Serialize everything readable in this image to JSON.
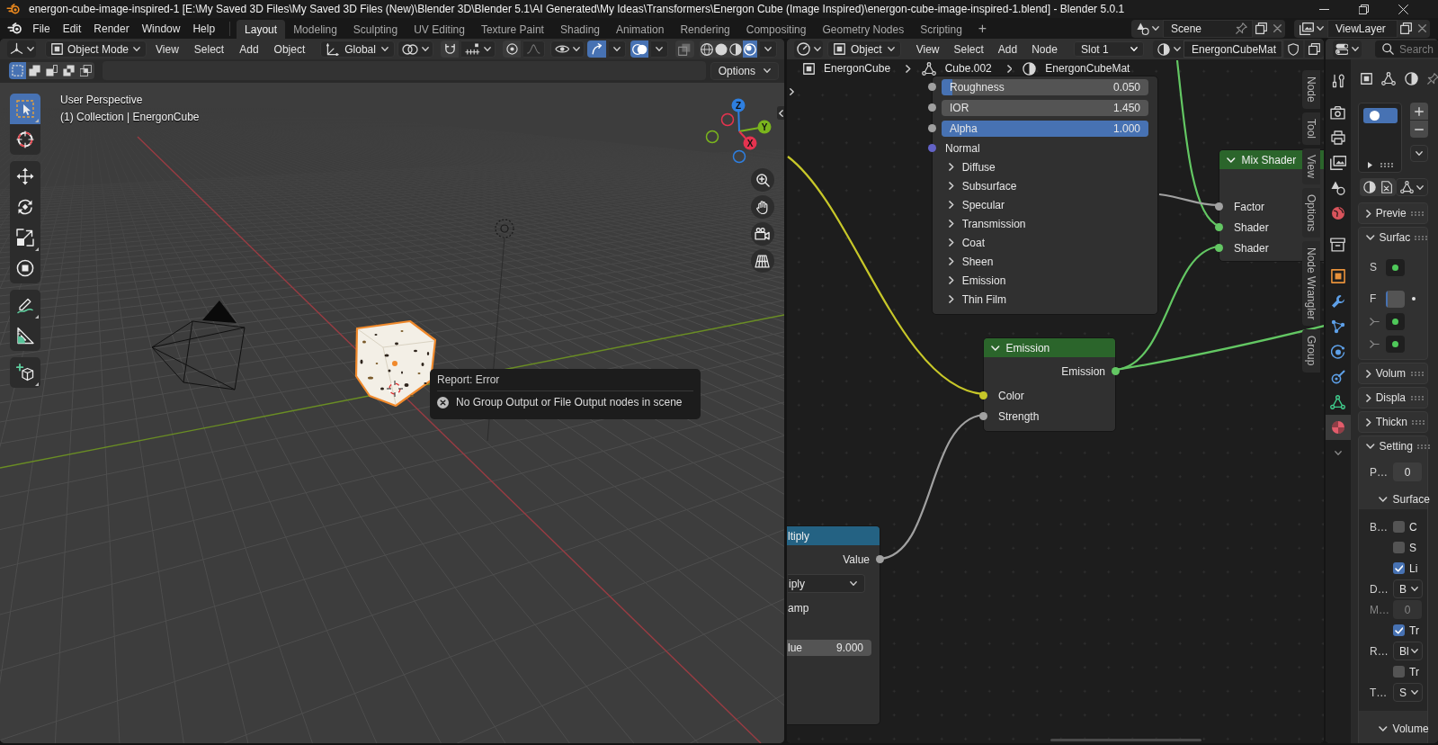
{
  "window": {
    "title": "energon-cube-image-inspired-1 [E:\\My Saved 3D Files\\My Saved 3D Files (New)\\Blender 3D\\Blender 5.1\\AI Generated\\My Ideas\\Transformers\\Energon Cube (Image Inspired)\\energon-cube-image-inspired-1.blend] - Blender 5.0.1"
  },
  "menu_bar": {
    "menus": [
      "File",
      "Edit",
      "Render",
      "Window",
      "Help"
    ]
  },
  "workspace_tabs": [
    {
      "label": "Layout",
      "selected": true
    },
    {
      "label": "Modeling",
      "selected": false
    },
    {
      "label": "Sculpting",
      "selected": false
    },
    {
      "label": "UV Editing",
      "selected": false
    },
    {
      "label": "Texture Paint",
      "selected": false
    },
    {
      "label": "Shading",
      "selected": false
    },
    {
      "label": "Animation",
      "selected": false
    },
    {
      "label": "Rendering",
      "selected": false
    },
    {
      "label": "Compositing",
      "selected": false
    },
    {
      "label": "Geometry Nodes",
      "selected": false
    },
    {
      "label": "Scripting",
      "selected": false
    }
  ],
  "add_workspace": "+",
  "scene": {
    "value": "Scene"
  },
  "view_layer": {
    "value": "ViewLayer"
  },
  "viewport": {
    "header": {
      "mode": "Object Mode",
      "menus": [
        "View",
        "Select",
        "Add",
        "Object"
      ],
      "orientation": "Global",
      "toggles": [
        {
          "kind": "gizmos",
          "on": true
        },
        {
          "kind": "overlays",
          "on": true
        },
        {
          "kind": "xray",
          "on": false
        }
      ],
      "shading": [
        {
          "kind": "wireframe",
          "selected": false
        },
        {
          "kind": "solid",
          "selected": false
        },
        {
          "kind": "material",
          "selected": false
        },
        {
          "kind": "rendered",
          "selected": true
        }
      ]
    },
    "select_modes": [
      {
        "kind": "set",
        "selected": true
      },
      {
        "kind": "extend",
        "selected": false
      },
      {
        "kind": "subtract",
        "selected": false
      },
      {
        "kind": "difference",
        "selected": false
      },
      {
        "kind": "intersect",
        "selected": false
      }
    ],
    "options": "Options",
    "view_name": "User Perspective",
    "collection": "(1) Collection | EnergonCube",
    "tools": [
      {
        "kind": "select",
        "selected": true
      },
      {
        "kind": "cursor",
        "selected": false
      },
      {
        "kind": "move",
        "selected": false
      },
      {
        "kind": "rotate",
        "selected": false
      },
      {
        "kind": "scale",
        "selected": false
      },
      {
        "kind": "transform",
        "selected": false
      },
      {
        "kind": "annotate",
        "selected": false
      },
      {
        "kind": "measure",
        "selected": false
      },
      {
        "kind": "add_cube",
        "selected": false
      }
    ],
    "axes": [
      {
        "label": "Z",
        "color": "#2e7fe0"
      },
      {
        "label": "Y",
        "color": "#7ab51d"
      },
      {
        "label": "X",
        "color": "#e5334f"
      }
    ],
    "report": {
      "title": "Report: Error",
      "message": "No Group Output or File Output nodes in scene"
    }
  },
  "node_editor": {
    "header": {
      "object_type": "Object",
      "menus": [
        "View",
        "Select",
        "Add",
        "Node"
      ],
      "slot": "Slot 1",
      "material": "EnergonCubeMat"
    },
    "breadcrumbs": [
      {
        "kind": "object",
        "label": "EnergonCube"
      },
      {
        "kind": "mesh",
        "label": "Cube.002"
      },
      {
        "kind": "material",
        "label": "EnergonCubeMat"
      }
    ],
    "nodes": [
      {
        "kind": "bsdf",
        "rows": [
          {
            "kind": "slider",
            "label": "Roughness",
            "value": "0.050",
            "level": 0.05,
            "color": "#a1a1a1"
          },
          {
            "kind": "field",
            "label": "IOR",
            "value": "1.450",
            "color": "#a1a1a1"
          },
          {
            "kind": "slider",
            "label": "Alpha",
            "value": "1.000",
            "level": 1,
            "color": "#a1a1a1"
          },
          {
            "kind": "socket",
            "label": "Normal",
            "color": "#6363c7"
          },
          {
            "kind": "panel",
            "label": "Diffuse",
            "expanded": false
          },
          {
            "kind": "panel",
            "label": "Subsurface",
            "expanded": false
          },
          {
            "kind": "panel",
            "label": "Specular",
            "expanded": false
          },
          {
            "kind": "panel",
            "label": "Transmission",
            "expanded": false
          },
          {
            "kind": "panel",
            "label": "Coat",
            "expanded": false
          },
          {
            "kind": "panel",
            "label": "Sheen",
            "expanded": false
          },
          {
            "kind": "panel",
            "label": "Emission",
            "expanded": false
          },
          {
            "kind": "panel",
            "label": "Thin Film",
            "expanded": false
          }
        ]
      },
      {
        "kind": "shader",
        "title": "Mix Shader",
        "expanded": true,
        "rows": [
          {
            "kind": "input",
            "label": "Factor",
            "color": "#a1a1a1"
          },
          {
            "kind": "input",
            "label": "Shader",
            "color": "#63c763"
          },
          {
            "kind": "input",
            "label": "Shader",
            "color": "#63c763"
          }
        ]
      },
      {
        "kind": "shader",
        "title": "Emission",
        "expanded": true,
        "rows": [
          {
            "kind": "output",
            "label": "Emission",
            "color": "#63c763"
          },
          {
            "kind": "input",
            "label": "Color",
            "color": "#c7c729"
          },
          {
            "kind": "input",
            "label": "Strength",
            "color": "#a1a1a1"
          }
        ]
      },
      {
        "kind": "converter",
        "title": "ltiply",
        "rows": [
          {
            "kind": "output",
            "label": "Value",
            "color": "#a1a1a1"
          },
          {
            "kind": "dropdown",
            "value": "iply"
          },
          {
            "kind": "text",
            "label": "amp"
          },
          {
            "kind": "field",
            "label": "lue",
            "value": "9.000"
          }
        ]
      }
    ],
    "links": [
      {
        "color": "#c7c729"
      },
      {
        "color": "#a1a1a1"
      },
      {
        "color": "#63c763"
      },
      {
        "color": "#63c763"
      },
      {
        "color": "#63c763"
      },
      {
        "color": "#a1a1a1"
      }
    ],
    "sidebar_tabs": [
      "Node",
      "Tool",
      "View",
      "Options",
      "Node Wrangler",
      "Group"
    ]
  },
  "properties": {
    "search": {
      "placeholder": "Search"
    },
    "tabs": [
      {
        "kind": "tool",
        "selected": false
      },
      {
        "kind": "render",
        "selected": false
      },
      {
        "kind": "output",
        "selected": false
      },
      {
        "kind": "view_layer",
        "selected": false
      },
      {
        "kind": "scene",
        "selected": false
      },
      {
        "kind": "world",
        "selected": false
      },
      {
        "kind": "collection",
        "selected": false
      },
      {
        "kind": "object",
        "selected": false
      },
      {
        "kind": "modifiers",
        "selected": false
      },
      {
        "kind": "particles",
        "selected": false
      },
      {
        "kind": "physics",
        "selected": false
      },
      {
        "kind": "constraints",
        "selected": false
      },
      {
        "kind": "data",
        "selected": false
      },
      {
        "kind": "material",
        "selected": true
      }
    ],
    "slots": [
      {
        "selected": true
      }
    ],
    "panels": [
      {
        "title": "Previe",
        "expanded": false
      },
      {
        "title": "Surfac",
        "expanded": true,
        "rows": [
          {
            "kind": "socket",
            "label": "S"
          },
          {
            "kind": "slider",
            "label": "F",
            "level": 0.1
          },
          {
            "kind": "linked"
          },
          {
            "kind": "linked"
          }
        ]
      },
      {
        "title": "Volum",
        "expanded": false
      },
      {
        "title": "Displa",
        "expanded": false
      },
      {
        "title": "Thickn",
        "expanded": false
      },
      {
        "title": "Setting",
        "expanded": true,
        "rows": [
          {
            "kind": "field",
            "label": "P…",
            "value": "0"
          }
        ],
        "subpanels": [
          {
            "title": "Surface",
            "expanded": true,
            "rows": [
              {
                "kind": "checkbox",
                "label": "B…",
                "text": "C",
                "checked": false,
                "disabled": false
              },
              {
                "kind": "checkbox",
                "text": "S",
                "checked": false,
                "disabled": false
              },
              {
                "kind": "checkbox",
                "text": "Li",
                "checked": true,
                "disabled": false
              },
              {
                "kind": "dropdown",
                "label": "D…",
                "value": "B",
                "disabled": false
              },
              {
                "kind": "field",
                "label": "M…",
                "value": "0",
                "disabled": true
              },
              {
                "kind": "checkbox",
                "text": "Tr",
                "checked": true,
                "disabled": false
              },
              {
                "kind": "dropdown",
                "label": "R…",
                "value": "Bl",
                "disabled": false
              },
              {
                "kind": "checkbox",
                "text": "Tr",
                "checked": false,
                "disabled": false
              },
              {
                "kind": "dropdown",
                "label": "T…",
                "value": "S",
                "disabled": false
              }
            ]
          },
          {
            "title": "Volume",
            "expanded": true
          }
        ]
      }
    ]
  }
}
